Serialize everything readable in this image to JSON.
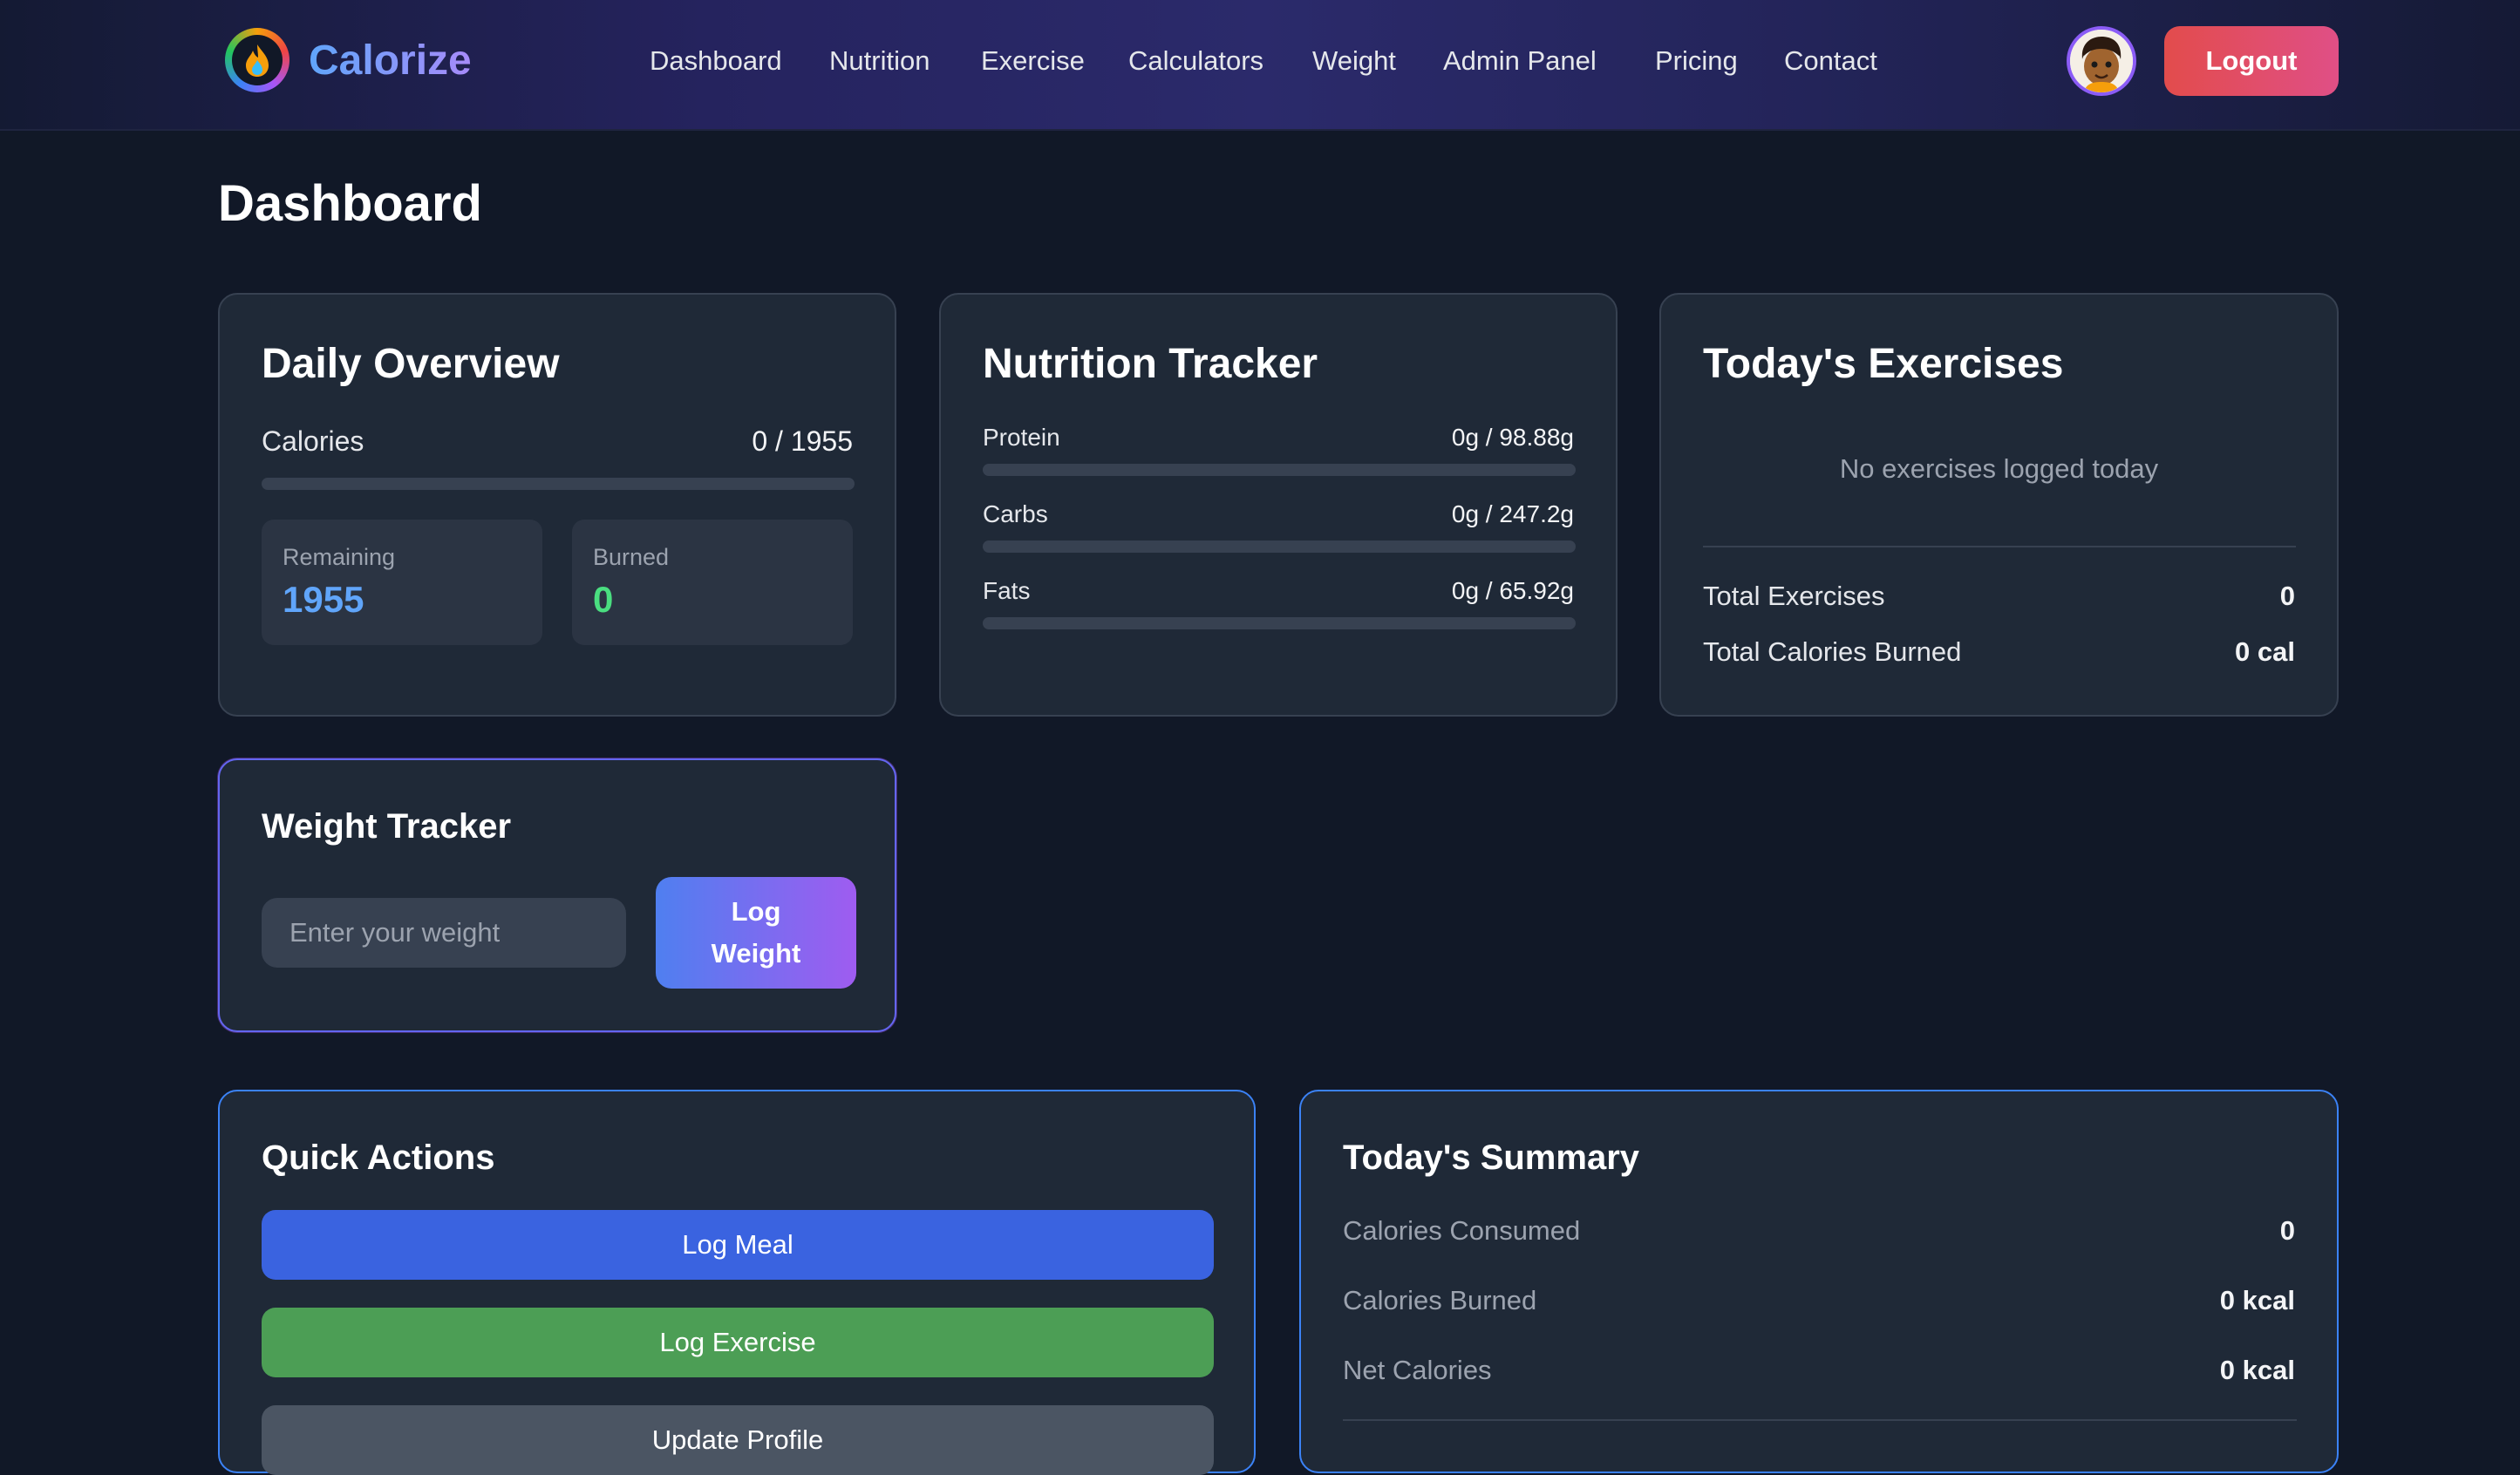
{
  "app": {
    "name": "Calorize"
  },
  "nav": {
    "links": [
      "Dashboard",
      "Nutrition",
      "Exercise",
      "Calculators",
      "Weight",
      "Admin Panel",
      "Pricing",
      "Contact"
    ],
    "logout_label": "Logout"
  },
  "page": {
    "title": "Dashboard"
  },
  "daily_overview": {
    "title": "Daily Overview",
    "calories_label": "Calories",
    "calories_value": "0 / 1955",
    "calories_progress": 0,
    "remaining_label": "Remaining",
    "remaining_value": "1955",
    "burned_label": "Burned",
    "burned_value": "0"
  },
  "nutrition_tracker": {
    "title": "Nutrition Tracker",
    "macros": [
      {
        "label": "Protein",
        "value": "0g / 98.88g",
        "progress": 0
      },
      {
        "label": "Carbs",
        "value": "0g / 247.2g",
        "progress": 0
      },
      {
        "label": "Fats",
        "value": "0g / 65.92g",
        "progress": 0
      }
    ]
  },
  "todays_exercises": {
    "title": "Today's Exercises",
    "empty_message": "No exercises logged today",
    "total_exercises_label": "Total Exercises",
    "total_exercises_value": "0",
    "total_burned_label": "Total Calories Burned",
    "total_burned_value": "0 cal"
  },
  "weight_tracker": {
    "title": "Weight Tracker",
    "input_placeholder": "Enter your weight",
    "input_value": "",
    "button_label": "Log Weight"
  },
  "quick_actions": {
    "title": "Quick Actions",
    "buttons": [
      {
        "label": "Log Meal",
        "color": "#3a63e0"
      },
      {
        "label": "Log Exercise",
        "color": "#4c9e55"
      },
      {
        "label": "Update Profile",
        "color": "#4b5563"
      }
    ]
  },
  "todays_summary": {
    "title": "Today's Summary",
    "rows": [
      {
        "label": "Calories Consumed",
        "value": "0"
      },
      {
        "label": "Calories Burned",
        "value": "0 kcal"
      },
      {
        "label": "Net Calories",
        "value": "0 kcal"
      }
    ]
  },
  "colors": {
    "accent_blue": "#60a5fa",
    "accent_green": "#4ade80",
    "logout_start": "#e24c4c",
    "logout_end": "#e04f86"
  }
}
